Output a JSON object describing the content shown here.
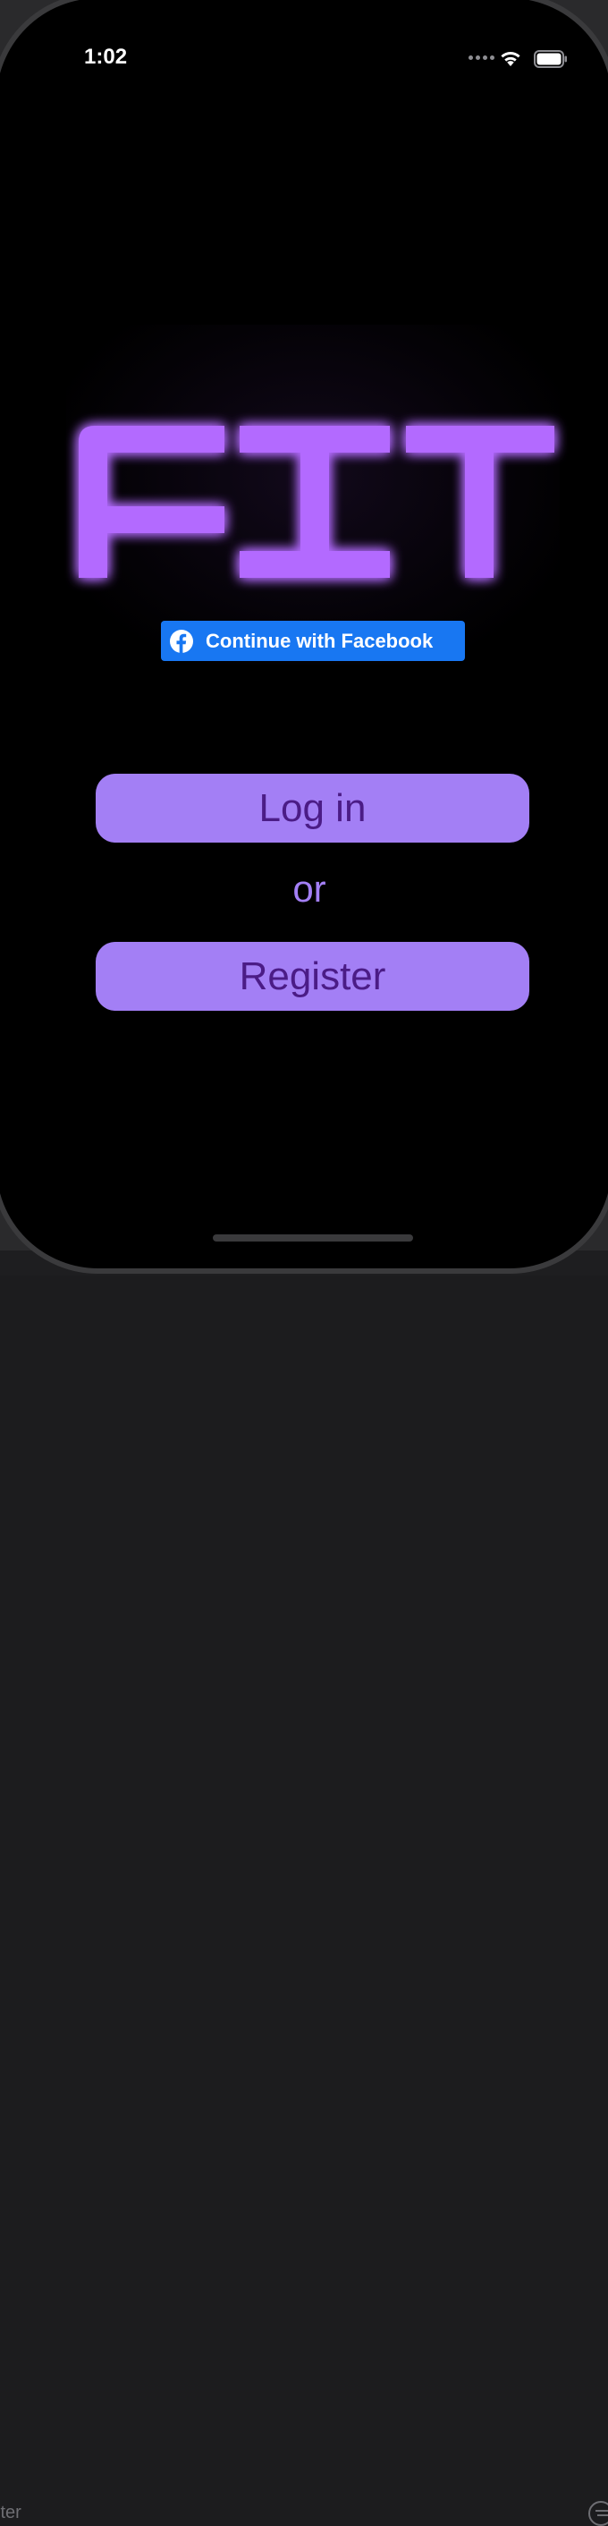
{
  "status_bar": {
    "time": "1:02",
    "signal_icon": "signal-dots-icon",
    "wifi_icon": "wifi-icon",
    "battery_icon": "battery-icon"
  },
  "logo": {
    "text": "FIT",
    "color": "#b36bff",
    "glow_color": "#8a2be2"
  },
  "facebook_button": {
    "label": "Continue with Facebook",
    "icon": "facebook-icon",
    "color": "#1877f2"
  },
  "login_button": {
    "label": "Log in"
  },
  "separator": {
    "text": "or"
  },
  "register_button": {
    "label": "Register"
  },
  "colors": {
    "accent": "#a37ff5",
    "button_text": "#4b1c86",
    "background": "#000000"
  },
  "simulator_chrome": {
    "filter_label": "lter"
  }
}
